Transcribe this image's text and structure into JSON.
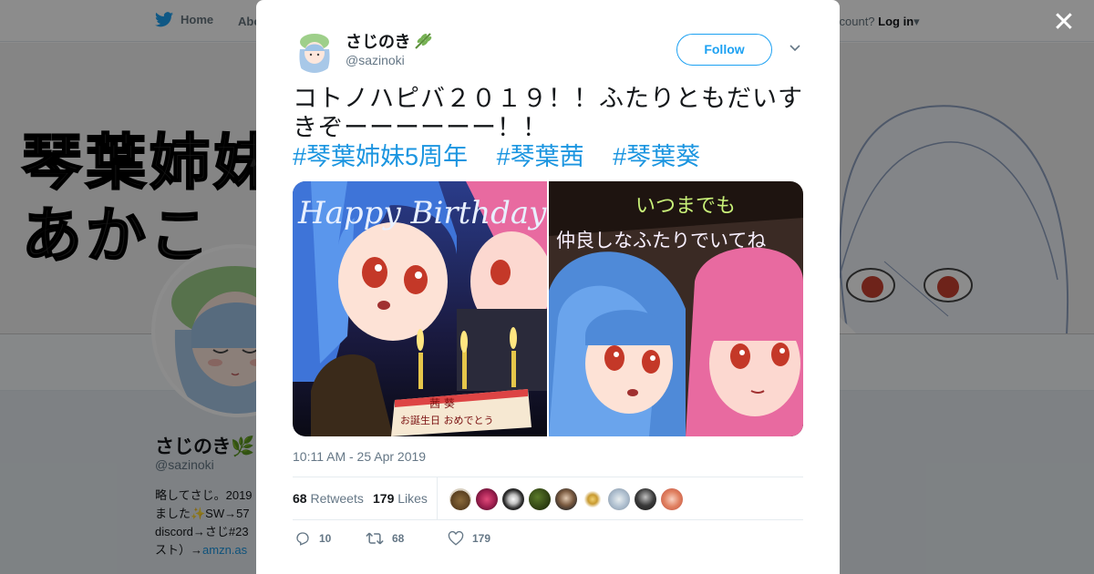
{
  "background": {
    "nav": {
      "home_label": "Home",
      "about_label": "Abo",
      "login_prompt": "ccount?",
      "login_label": "Log in"
    },
    "banner_text_line1": "琴葉姉妹",
    "banner_text_line2": "あかこ",
    "profile": {
      "name": "さじのき🌿",
      "handle": "@sazinoki",
      "bio_line1": "略してさじ。2019",
      "bio_line2": "ました✨SW→57",
      "bio_line3": "discord→さじ#23",
      "bio_line4_prefix": "スト）→",
      "bio_link": "amzn.as"
    }
  },
  "modal": {
    "author": {
      "name": "さじのき",
      "handle": "@sazinoki"
    },
    "follow_label": "Follow",
    "tweet_text": "コトノハピバ２０１９！！ふたりともだいすきぞーーーーーー！！",
    "hashtags": [
      "#琴葉姉妹5周年",
      "#琴葉茜",
      "#琴葉葵"
    ],
    "media": [
      {
        "image_text_top": "Happy Birthday",
        "cake_text1": "茜 葵",
        "cake_text2": "お誕生日 おめでとう"
      },
      {
        "image_text_top": "いつまでも",
        "image_text_bottom": "仲良しなふたりでいてね"
      }
    ],
    "timestamp": "10:11 AM - 25 Apr 2019",
    "stats": {
      "retweets_count": "68",
      "retweets_label": "Retweets",
      "likes_count": "179",
      "likes_label": "Likes"
    },
    "actions": {
      "reply_count": "10",
      "retweet_count": "68",
      "like_count": "179"
    }
  },
  "colors": {
    "accent": "#1da1f2",
    "link": "#1b95e0",
    "text": "#14171a",
    "muted": "#657786"
  }
}
